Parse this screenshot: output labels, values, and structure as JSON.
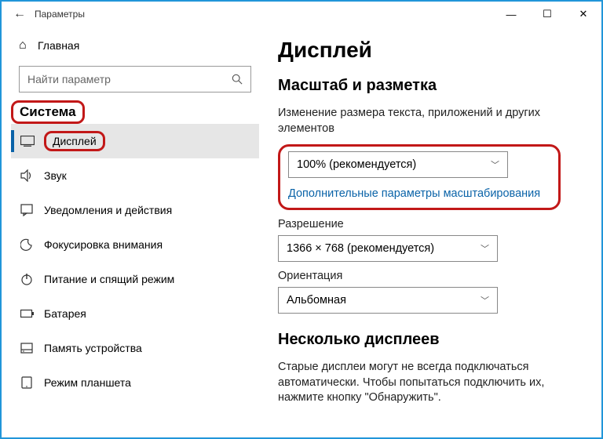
{
  "window": {
    "title": "Параметры",
    "min": "—",
    "max": "☐",
    "close": "✕",
    "back": "←"
  },
  "sidebar": {
    "home": "Главная",
    "search_placeholder": "Найти параметр",
    "category": "Система",
    "items": [
      {
        "label": "Дисплей"
      },
      {
        "label": "Звук"
      },
      {
        "label": "Уведомления и действия"
      },
      {
        "label": "Фокусировка внимания"
      },
      {
        "label": "Питание и спящий режим"
      },
      {
        "label": "Батарея"
      },
      {
        "label": "Память устройства"
      },
      {
        "label": "Режим планшета"
      }
    ]
  },
  "content": {
    "h1": "Дисплей",
    "scale_h2": "Масштаб и разметка",
    "scale_desc": "Изменение размера текста, приложений и других элементов",
    "scale_value": "100% (рекомендуется)",
    "scale_link": "Дополнительные параметры масштабирования",
    "res_label": "Разрешение",
    "res_value": "1366 × 768 (рекомендуется)",
    "orient_label": "Ориентация",
    "orient_value": "Альбомная",
    "multi_h2": "Несколько дисплеев",
    "multi_desc": "Старые дисплеи могут не всегда подключаться автоматически. Чтобы попытаться подключить их, нажмите кнопку \"Обнаружить\"."
  }
}
